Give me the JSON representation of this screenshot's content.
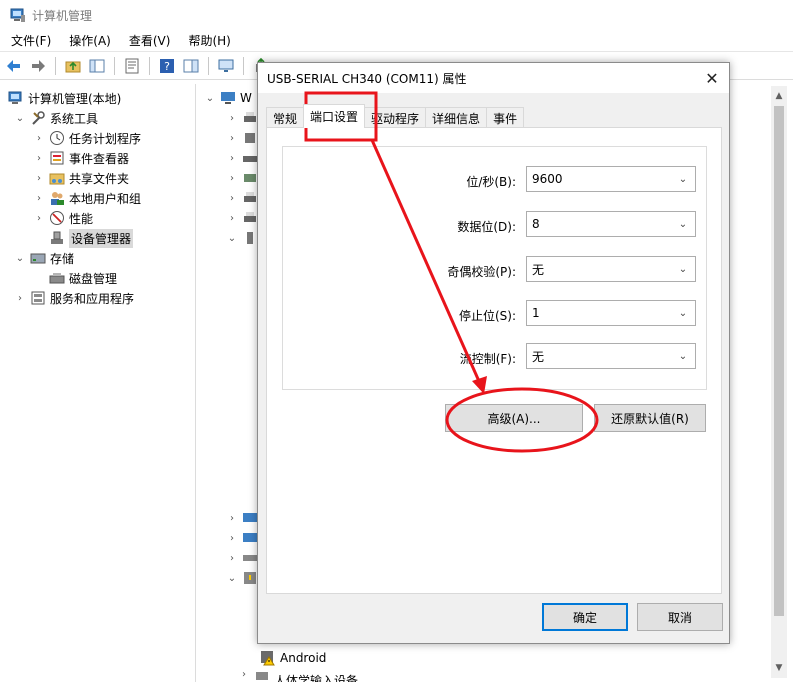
{
  "window": {
    "title": "计算机管理"
  },
  "menu": [
    "文件(F)",
    "操作(A)",
    "查看(V)",
    "帮助(H)"
  ],
  "tree": {
    "root": "计算机管理(本地)",
    "items": [
      {
        "label": "系统工具",
        "level": 1,
        "expanded": true
      },
      {
        "label": "任务计划程序",
        "level": 2
      },
      {
        "label": "事件查看器",
        "level": 2
      },
      {
        "label": "共享文件夹",
        "level": 2
      },
      {
        "label": "本地用户和组",
        "level": 2
      },
      {
        "label": "性能",
        "level": 2
      },
      {
        "label": "设备管理器",
        "level": 2,
        "selected": true
      },
      {
        "label": "存储",
        "level": 1,
        "expanded": true
      },
      {
        "label": "磁盘管理",
        "level": 2
      },
      {
        "label": "服务和应用程序",
        "level": 1
      }
    ]
  },
  "right_panel": {
    "visible_label_top": "W",
    "android_label": "Android",
    "partial_bottom": "人体学输入设备"
  },
  "dialog": {
    "title": "USB-SERIAL CH340 (COM11) 属性",
    "tabs": [
      "常规",
      "端口设置",
      "驱动程序",
      "详细信息",
      "事件"
    ],
    "active_tab": 1,
    "fields": [
      {
        "label": "位/秒(B):",
        "value": "9600"
      },
      {
        "label": "数据位(D):",
        "value": "8"
      },
      {
        "label": "奇偶校验(P):",
        "value": "无"
      },
      {
        "label": "停止位(S):",
        "value": "1"
      },
      {
        "label": "流控制(F):",
        "value": "无"
      }
    ],
    "advanced_button": "高级(A)...",
    "restore_button": "还原默认值(R)",
    "ok_button": "确定",
    "cancel_button": "取消"
  },
  "colors": {
    "annotation": "#e8141b",
    "accent": "#0078d7"
  }
}
